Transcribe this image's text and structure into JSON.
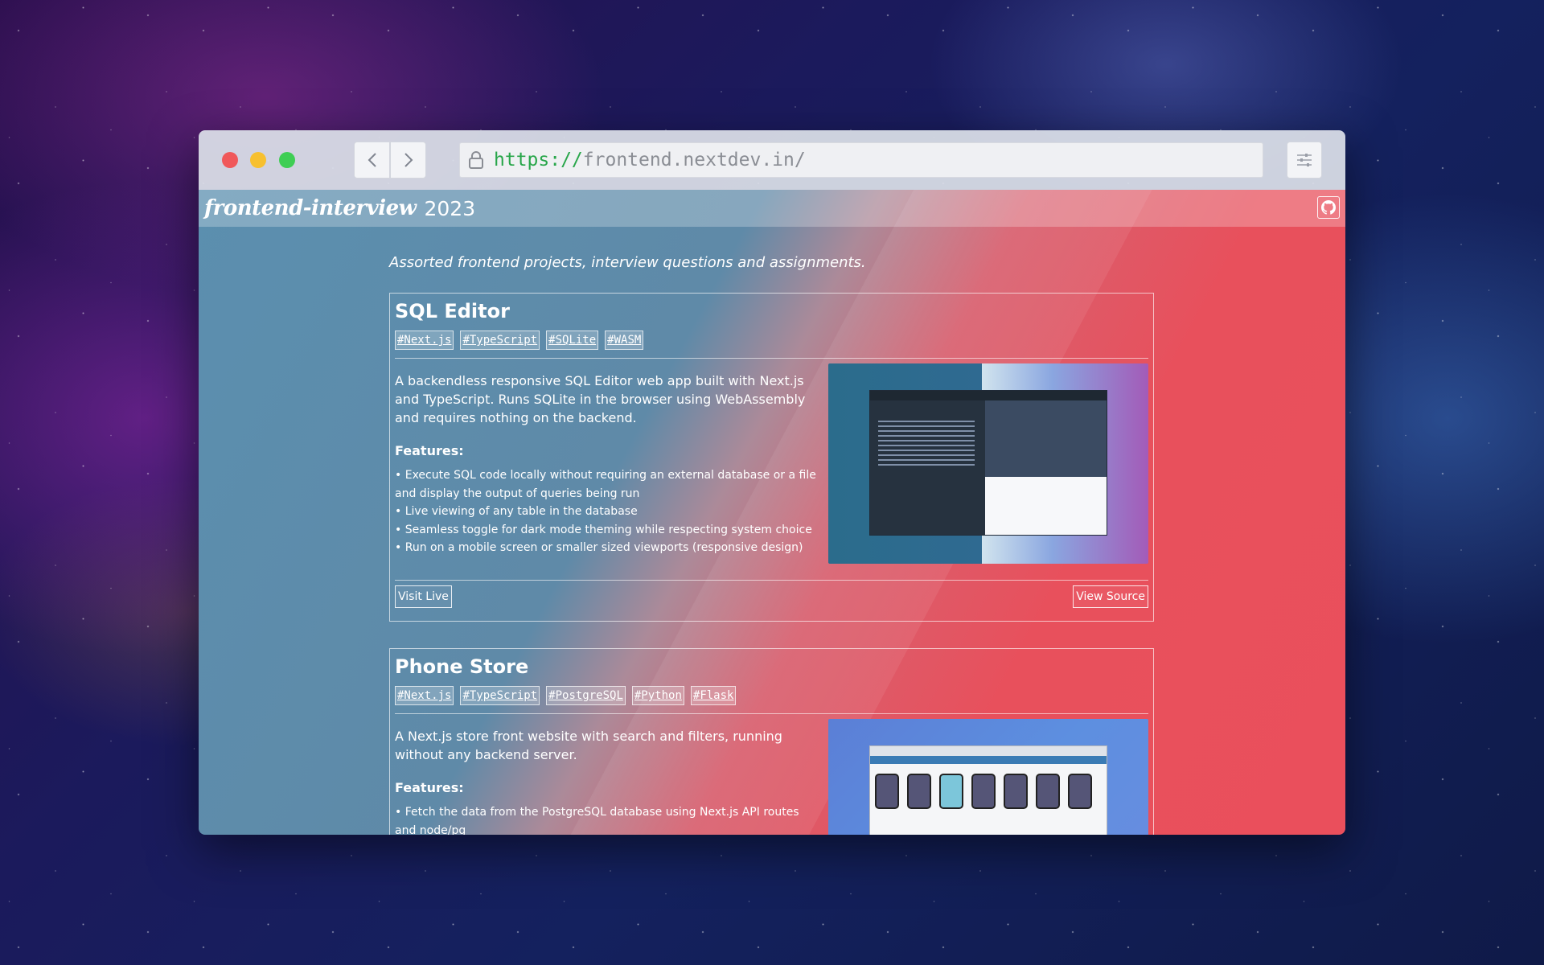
{
  "browser": {
    "url_protocol": "https://",
    "url_host": "frontend.nextdev.in/"
  },
  "site": {
    "brand": "frontend-interview",
    "year": "2023",
    "tagline": "Assorted frontend projects, interview questions and assignments."
  },
  "projects": [
    {
      "title": "SQL Editor",
      "tags": [
        "#Next.js",
        "#TypeScript",
        "#SQLite",
        "#WASM"
      ],
      "description": "A backendless responsive SQL Editor web app built with Next.js and TypeScript. Runs SQLite in the browser using WebAssembly and requires nothing on the backend.",
      "features_heading": "Features:",
      "features": [
        "Execute SQL code locally without requiring an external database or a file and display the output of queries being run",
        "Live viewing of any table in the database",
        "Seamless toggle for dark mode theming while respecting system choice",
        "Run on a mobile screen or smaller sized viewports (responsive design)"
      ],
      "visit_label": "Visit Live",
      "source_label": "View Source"
    },
    {
      "title": "Phone Store",
      "tags": [
        "#Next.js",
        "#TypeScript",
        "#PostgreSQL",
        "#Python",
        "#Flask"
      ],
      "description": "A Next.js store front website with search and filters, running without any backend server.",
      "features_heading": "Features:",
      "features": [
        "Fetch the data from the PostgreSQL database using Next.js API routes and node/pg"
      ]
    }
  ],
  "icons": {
    "lock": "lock-icon",
    "back": "chevron-left-icon",
    "forward": "chevron-right-icon",
    "menu": "sliders-icon",
    "github": "github-icon"
  }
}
